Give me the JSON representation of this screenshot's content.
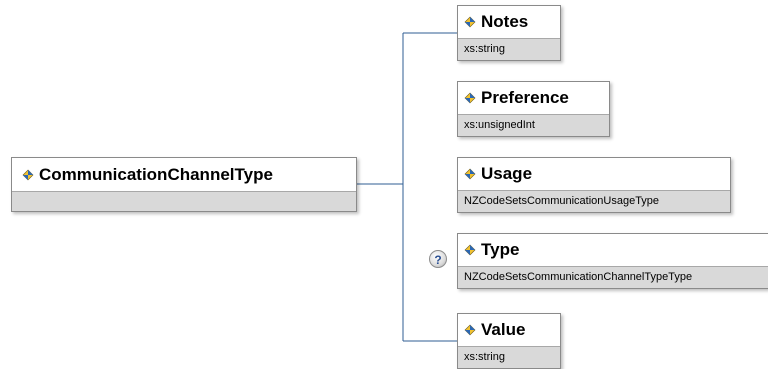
{
  "root": {
    "name": "CommunicationChannelType"
  },
  "children": [
    {
      "name": "Notes",
      "type": "xs:string"
    },
    {
      "name": "Preference",
      "type": "xs:unsignedInt"
    },
    {
      "name": "Usage",
      "type": "NZCodeSetsCommunicationUsageType"
    },
    {
      "name": "Type",
      "type": "NZCodeSetsCommunicationChannelTypeType"
    },
    {
      "name": "Value",
      "type": "xs:string"
    }
  ],
  "help": {
    "symbol": "?"
  },
  "icons": {
    "element": "element-diamond-icon",
    "help": "question-mark-icon"
  },
  "colors": {
    "connector": "#2f5e93",
    "node_border": "#8a8a8a",
    "type_band": "#d9d9d9",
    "icon_blue": "#2b67b3",
    "icon_yellow": "#f2c230"
  }
}
